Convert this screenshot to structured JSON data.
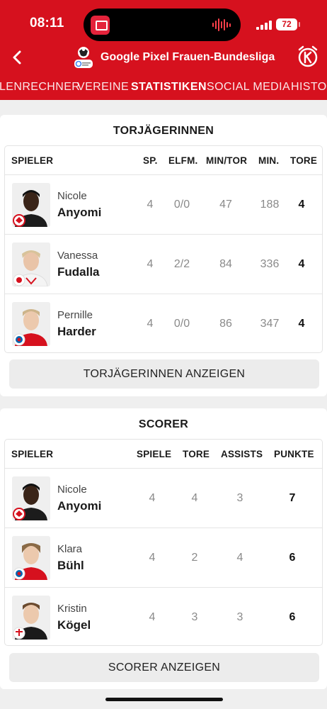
{
  "status": {
    "time": "08:11",
    "battery": "72"
  },
  "nav": {
    "title": "Google Pixel Frauen-Bundesliga"
  },
  "tabs": [
    "LENRECHNER",
    "VEREINE",
    "STATISTIKEN",
    "SOCIAL MEDIA",
    "HISTOR"
  ],
  "scorers_top": {
    "title": "TORJÄGERINNEN",
    "columns": [
      "SPIELER",
      "SP.",
      "ELFM.",
      "MIN/TOR",
      "MIN.",
      "TORE"
    ],
    "rows": [
      {
        "first": "Nicole",
        "last": "Anyomi",
        "sp": "4",
        "elfm": "0/0",
        "min_tor": "47",
        "min": "188",
        "tore": "4",
        "club": "eintracht-frankfurt"
      },
      {
        "first": "Vanessa",
        "last": "Fudalla",
        "sp": "4",
        "elfm": "2/2",
        "min_tor": "84",
        "min": "336",
        "tore": "4",
        "club": "rb-leipzig"
      },
      {
        "first": "Pernille",
        "last": "Harder",
        "sp": "4",
        "elfm": "0/0",
        "min_tor": "86",
        "min": "347",
        "tore": "4",
        "club": "fc-bayern"
      }
    ],
    "button": "TORJÄGERINNEN ANZEIGEN"
  },
  "scorer": {
    "title": "SCORER",
    "columns": [
      "SPIELER",
      "SPIELE",
      "TORE",
      "ASSISTS",
      "PUNKTE"
    ],
    "rows": [
      {
        "first": "Nicole",
        "last": "Anyomi",
        "spiele": "4",
        "tore": "4",
        "assists": "3",
        "punkte": "7",
        "club": "eintracht-frankfurt"
      },
      {
        "first": "Klara",
        "last": "Bühl",
        "spiele": "4",
        "tore": "2",
        "assists": "4",
        "punkte": "6",
        "club": "fc-bayern"
      },
      {
        "first": "Kristin",
        "last": "Kögel",
        "spiele": "4",
        "tore": "3",
        "assists": "3",
        "punkte": "6",
        "club": "bayer-leverkusen"
      }
    ],
    "button": "SCORER ANZEIGEN"
  },
  "colors": {
    "brand_red": "#d6111e",
    "text_muted": "#8a8a8a",
    "button_bg": "#ececec"
  }
}
